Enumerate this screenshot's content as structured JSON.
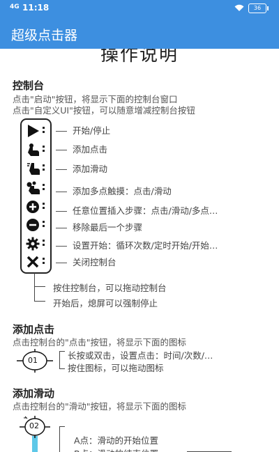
{
  "status": {
    "signal": "4G",
    "time": "11:18",
    "battery": "36"
  },
  "app": {
    "title": "超级点击器"
  },
  "page": {
    "title": "操作说明"
  },
  "console": {
    "title": "控制台",
    "desc1": "点击\"启动\"按钮，将显示下面的控制台窗口",
    "desc2": "点击\"自定义UI\"按钮，可以随意增减控制台按钮",
    "items": [
      {
        "icon": "play-icon",
        "label": "开始/停止"
      },
      {
        "icon": "tap-icon",
        "label": "添加点击"
      },
      {
        "icon": "swipe-icon",
        "label": "添加滑动"
      },
      {
        "icon": "multi-touch-icon",
        "label": "添加多点触摸：点击/滑动"
      },
      {
        "icon": "plus-circle-icon",
        "label": "任意位置插入步骤：点击/滑动/多点…"
      },
      {
        "icon": "minus-circle-icon",
        "label": "移除最后一个步骤"
      },
      {
        "icon": "gear-icon",
        "label": "设置开始：循环次数/定时开始/开始…"
      },
      {
        "icon": "close-icon",
        "label": "关闭控制台"
      }
    ],
    "note1": "按住控制台，可以拖动控制台",
    "note2": "开始后，熄屏可以强制停止"
  },
  "add_click": {
    "title": "添加点击",
    "desc": "点击控制台的\"点击\"按钮，将显示下面的图标",
    "target_label": "01",
    "note1": "长按或双击，设置点击：时间/次数/…",
    "note2": "按住图标，可以拖动图标"
  },
  "add_swipe": {
    "title": "添加滑动",
    "desc": "点击控制台的\"滑动\"按钮，将显示下面的图标",
    "target_label": "02",
    "note1": "A点：滑动的开始位置",
    "note2": "B点：滑动的结束位置"
  },
  "colors": {
    "primary": "#3d8fe0",
    "accent_cyan": "#5ec8e8"
  }
}
